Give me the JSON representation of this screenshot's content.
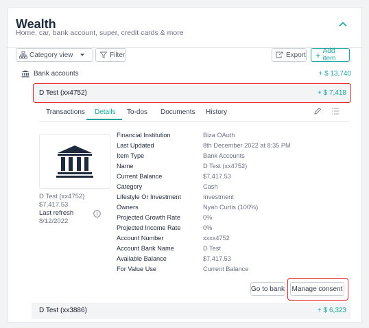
{
  "header": {
    "title": "Wealth",
    "subtitle": "Home, car, bank account, super, credit cards & more"
  },
  "toolbar": {
    "category_view": "Category view",
    "filter": "Filter",
    "export": "Export",
    "add_item": "Add item"
  },
  "section": {
    "label": "Bank accounts",
    "amount": "+ $ 13,740"
  },
  "account1": {
    "name": "D Test (xx4752)",
    "amount": "+ $ 7,418"
  },
  "tabs": [
    "Transactions",
    "Details",
    "To-dos",
    "Documents",
    "History"
  ],
  "summary": {
    "name": "D Test (xx4752)",
    "balance": "$7,417.53",
    "refresh_label": "Last refresh",
    "refresh_date": "8/12/2022"
  },
  "details": [
    {
      "label": "Financial Institution",
      "value": "Biza OAuth"
    },
    {
      "label": "Last Updated",
      "value": "8th December 2022 at 8:35 PM"
    },
    {
      "label": "Item Type",
      "value": "Bank Accounts"
    },
    {
      "label": "Name",
      "value": "D Test (xx4752)"
    },
    {
      "label": "Current Balance",
      "value": "$7,417.53"
    },
    {
      "label": "Category",
      "value": "Cash"
    },
    {
      "label": "Lifestyle Or Investment",
      "value": "Investment"
    },
    {
      "label": "Owners",
      "value": "Nyah Curtis (100%)"
    },
    {
      "label": "Projected Growth Rate",
      "value": "0%"
    },
    {
      "label": "Projected Income Rate",
      "value": "0%"
    },
    {
      "label": "Account Number",
      "value": "xxxx4752"
    },
    {
      "label": "Account Bank Name",
      "value": "D Test"
    },
    {
      "label": "Available Balance",
      "value": "$7,417.53"
    },
    {
      "label": "For Value Use",
      "value": "Current Balance"
    }
  ],
  "actions": {
    "go_to_bank": "Go to bank",
    "manage_consent": "Manage consent"
  },
  "account2": {
    "name": "D Test (xx3886)",
    "amount": "+ $ 6,323"
  },
  "colors": {
    "accent": "#1aa39a",
    "highlight": "#e0262c"
  }
}
